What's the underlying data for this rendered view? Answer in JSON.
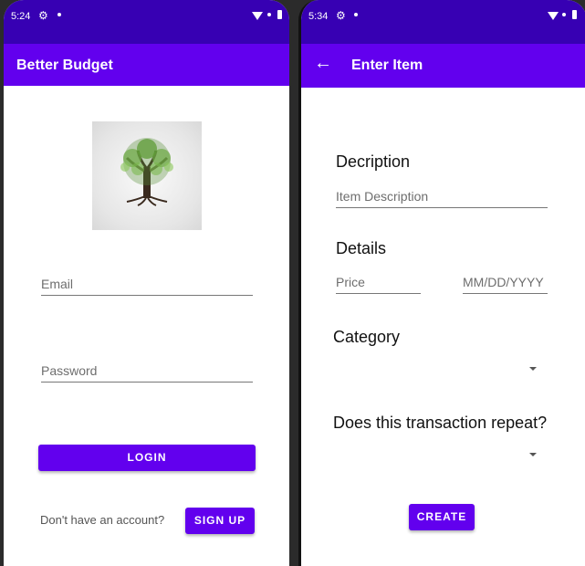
{
  "colors": {
    "status_bar": "#3700b3",
    "app_bar": "#6200ee",
    "button": "#6200ee"
  },
  "login_screen": {
    "status": {
      "time": "5:24"
    },
    "app_title": "Better Budget",
    "logo_icon": "tree-of-life-logo",
    "email_placeholder": "Email",
    "password_placeholder": "Password",
    "login_button": "LOGIN",
    "no_account_text": "Don't have an account?",
    "signup_button": "SIGN UP"
  },
  "enter_item_screen": {
    "status": {
      "time": "5:34"
    },
    "app_title": "Enter Item",
    "back_icon": "arrow-left-icon",
    "description_heading": "Decription",
    "description_placeholder": "Item Description",
    "details_heading": "Details",
    "price_placeholder": "Price",
    "date_placeholder": "MM/DD/YYYY",
    "category_heading": "Category",
    "repeat_heading": "Does this transaction repeat?",
    "create_button": "CREATE"
  }
}
